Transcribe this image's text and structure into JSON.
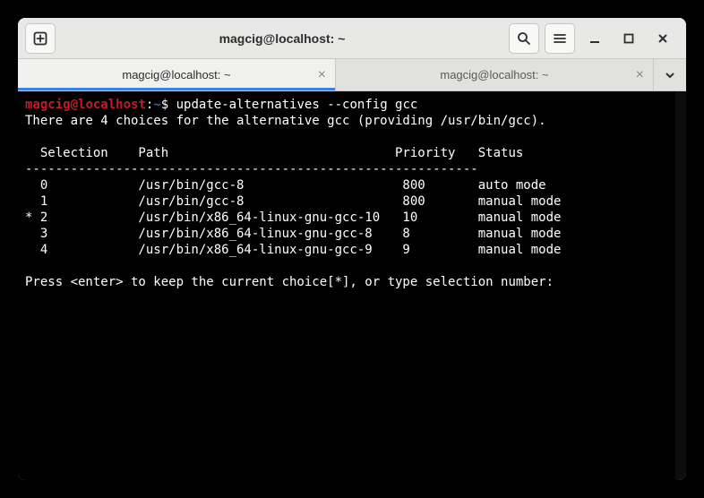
{
  "window": {
    "title": "magcig@localhost: ~"
  },
  "tabs": [
    {
      "label": "magcig@localhost: ~",
      "active": true
    },
    {
      "label": "magcig@localhost: ~",
      "active": false
    }
  ],
  "prompt": {
    "user": "magcig",
    "at": "@",
    "host": "localhost",
    "colon": ":",
    "path": "~",
    "symbol": "$"
  },
  "command": "update-alternatives --config gcc",
  "output": {
    "intro": "There are 4 choices for the alternative gcc (providing /usr/bin/gcc).",
    "header": "  Selection    Path                              Priority   Status",
    "sep": "------------------------------------------------------------",
    "rows": [
      "  0            /usr/bin/gcc-8                     800       auto mode",
      "  1            /usr/bin/gcc-8                     800       manual mode",
      "* 2            /usr/bin/x86_64-linux-gnu-gcc-10   10        manual mode",
      "  3            /usr/bin/x86_64-linux-gnu-gcc-8    8         manual mode",
      "  4            /usr/bin/x86_64-linux-gnu-gcc-9    9         manual mode"
    ],
    "prompt_line": "Press <enter> to keep the current choice[*], or type selection number:"
  }
}
